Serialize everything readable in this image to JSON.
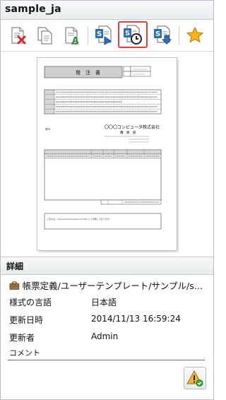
{
  "window": {
    "title": "sample_ja"
  },
  "toolbar": {
    "buttons": [
      {
        "name": "delete-document",
        "icon": "document-delete-icon"
      },
      {
        "name": "copy-document",
        "icon": "document-copy-icon"
      },
      {
        "name": "rename-document",
        "icon": "document-rename-icon"
      },
      {
        "name": "open-in-designer",
        "icon": "designer-open-icon"
      },
      {
        "name": "history",
        "icon": "designer-history-icon",
        "selected": true
      },
      {
        "name": "download",
        "icon": "designer-download-icon"
      },
      {
        "name": "favorite",
        "icon": "star-icon"
      }
    ]
  },
  "preview": {
    "document_title": "発　注　書",
    "company_name": "〇〇〇コンピュータ株式会社",
    "company_sub": "購　買　部",
    "footer_note": "ご注文は、Sigma Press Personal Printer にて印刷しております。"
  },
  "details": {
    "header": "詳細",
    "path": "帳票定義/ユーザーテンプレート/サンプル/sampl...",
    "rows": [
      {
        "label": "様式の言語",
        "value": "日本語"
      },
      {
        "label": "更新日時",
        "value": "2014/11/13 16:59:24"
      },
      {
        "label": "更新者",
        "value": "Admin"
      }
    ],
    "comment_label": "コメント",
    "comment_value": ""
  },
  "colors": {
    "selected_border": "#e0403a",
    "accent_blue": "#2d6fb7",
    "star": "#f5b417"
  }
}
